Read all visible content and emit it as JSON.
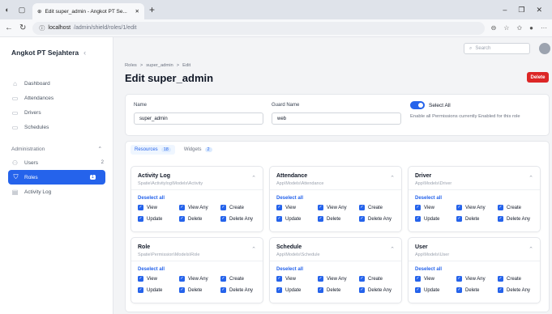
{
  "browser": {
    "tab_title": "Edit super_admin - Angkot PT Se...",
    "url_host": "localhost",
    "url_path": "/admin/shield/roles/1/edit"
  },
  "app": {
    "brand": "Angkot PT Sejahtera"
  },
  "sidebar": {
    "items": [
      {
        "label": "Dashboard",
        "icon": "home-icon"
      },
      {
        "label": "Attendances",
        "icon": "folder-icon"
      },
      {
        "label": "Drivers",
        "icon": "folder-icon"
      },
      {
        "label": "Schedules",
        "icon": "folder-icon"
      }
    ],
    "group": {
      "label": "Administration"
    },
    "admin_items": [
      {
        "label": "Users",
        "badge": "2"
      },
      {
        "label": "Roles",
        "badge": "1"
      },
      {
        "label": "Activity Log",
        "badge": ""
      }
    ]
  },
  "topbar": {
    "search_placeholder": "Search"
  },
  "page": {
    "breadcrumb": [
      "Roles",
      ">",
      "super_admin",
      ">",
      "Edit"
    ],
    "title": "Edit super_admin",
    "delete_label": "Delete"
  },
  "form": {
    "name_label": "Name",
    "name_value": "super_admin",
    "guard_label": "Guard Name",
    "guard_value": "web",
    "select_all_label": "Select All",
    "select_all_help": "Enable all Permissions currently Enabled for this role"
  },
  "tabs": [
    {
      "label": "Resources",
      "count": "18"
    },
    {
      "label": "Widgets",
      "count": "2"
    }
  ],
  "deselect_label": "Deselect all",
  "permission_labels": [
    "View",
    "View Any",
    "Create",
    "Update",
    "Delete",
    "Delete Any"
  ],
  "resources": [
    {
      "title": "Activity Log",
      "model": "Spatie\\Activitylog\\Models\\Activity"
    },
    {
      "title": "Attendance",
      "model": "App\\Models\\Attendance"
    },
    {
      "title": "Driver",
      "model": "App\\Models\\Driver"
    },
    {
      "title": "Role",
      "model": "Spatie\\Permission\\Models\\Role"
    },
    {
      "title": "Schedule",
      "model": "App\\Models\\Schedule"
    },
    {
      "title": "User",
      "model": "App\\Models\\User"
    }
  ],
  "colors": {
    "primary": "#2563eb",
    "danger": "#dc2626"
  }
}
